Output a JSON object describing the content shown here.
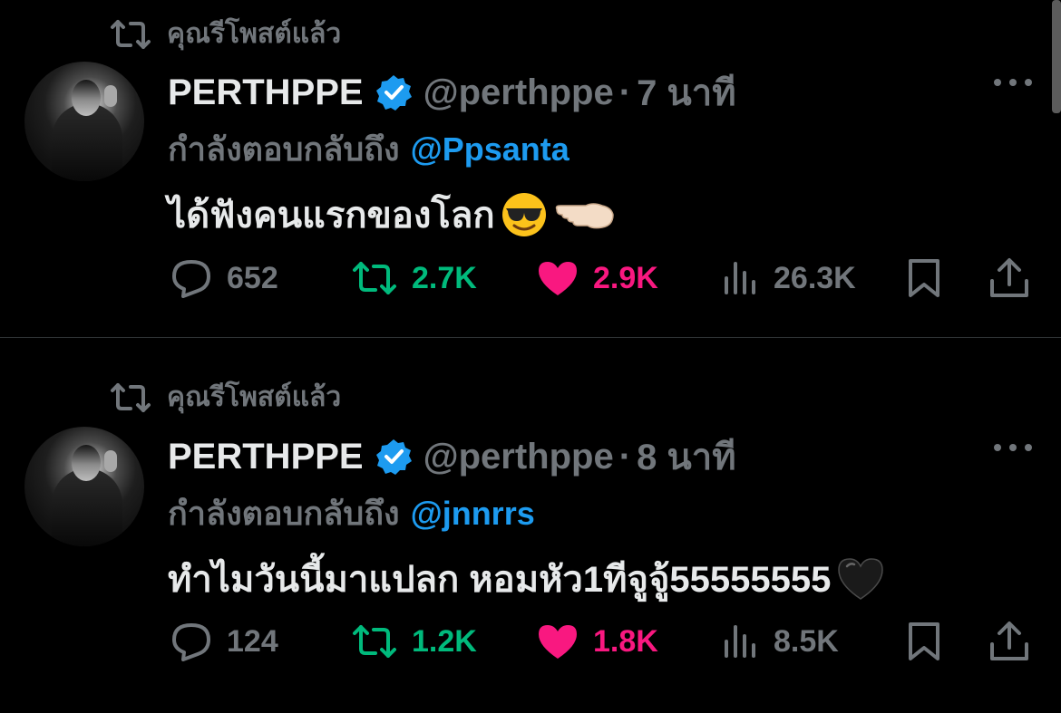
{
  "theme": {
    "background": "#000000",
    "text": "#e7e9ea",
    "muted": "#71767b",
    "link": "#1d9bf0",
    "retweet_active": "#00ba7c",
    "like_active": "#f91880",
    "verified_badge": "#1d9bf0"
  },
  "tweets": [
    {
      "social_context": "คุณรีโพสต์แล้ว",
      "display_name": "PERTHPPE",
      "handle": "@perthppe",
      "separator": "·",
      "time": "7 นาที",
      "reply_prefix": "กำลังตอบกลับถึง",
      "reply_to": "@Ppsanta",
      "text": "ได้ฟังคนแรกของโลก",
      "emojis": [
        "smiling-face-with-sunglasses",
        "backhand-index-pointing-left"
      ],
      "replies": "652",
      "reposts": "2.7K",
      "likes": "2.9K",
      "views": "26.3K"
    },
    {
      "social_context": "คุณรีโพสต์แล้ว",
      "display_name": "PERTHPPE",
      "handle": "@perthppe",
      "separator": "·",
      "time": "8 นาที",
      "reply_prefix": "กำลังตอบกลับถึง",
      "reply_to": "@jnnrrs",
      "text": "ทำไมวันนี้มาแปลก หอมหัว1ทีจูจู้55555555",
      "emojis": [
        "black-heart"
      ],
      "replies": "124",
      "reposts": "1.2K",
      "likes": "1.8K",
      "views": "8.5K"
    }
  ]
}
